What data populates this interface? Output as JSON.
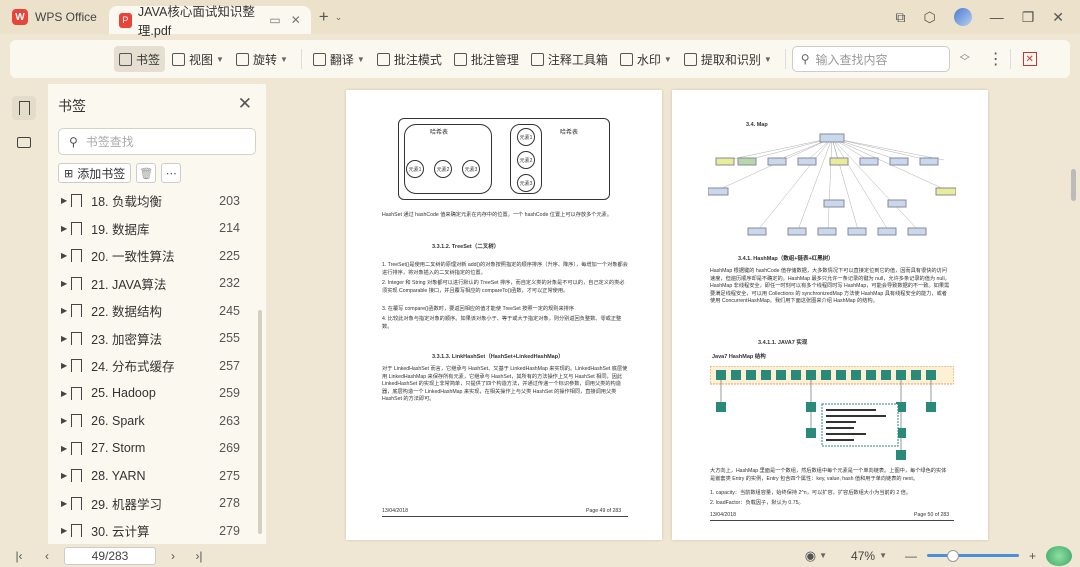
{
  "titlebar": {
    "app_name": "WPS Office",
    "doc_tab_title": "JAVA核心面试知识整理.pdf"
  },
  "toolbar": {
    "bookmark": "书签",
    "view": "视图",
    "rotate": "旋转",
    "translate": "翻译",
    "annotate_mode": "批注模式",
    "annotate_manage": "批注管理",
    "annot_tools": "注释工具箱",
    "watermark": "水印",
    "extract": "提取和识别",
    "search_placeholder": "输入查找内容"
  },
  "panel": {
    "title": "书签",
    "search_placeholder": "书签查找",
    "add_label": "添加书签",
    "items": [
      {
        "label": "18. 负载均衡",
        "page": "203"
      },
      {
        "label": "19. 数据库",
        "page": "214"
      },
      {
        "label": "20. 一致性算法",
        "page": "225"
      },
      {
        "label": "21. JAVA算法",
        "page": "232"
      },
      {
        "label": "22. 数据结构",
        "page": "245"
      },
      {
        "label": "23. 加密算法",
        "page": "255"
      },
      {
        "label": "24. 分布式缓存",
        "page": "257"
      },
      {
        "label": "25. Hadoop",
        "page": "259"
      },
      {
        "label": "26. Spark",
        "page": "263"
      },
      {
        "label": "27. Storm",
        "page": "269"
      },
      {
        "label": "28. YARN",
        "page": "275"
      },
      {
        "label": "29. 机器学习",
        "page": "278"
      },
      {
        "label": "30. 云计算",
        "page": "279"
      }
    ]
  },
  "left_page": {
    "hash_label": "哈希表",
    "hash_label2": "哈希表",
    "elements": [
      "元素1",
      "元素2",
      "元素3"
    ],
    "elements2": [
      "元素1",
      "元素2",
      "元素3"
    ],
    "para1": "HashSet 通过 hashCode 值来确定元素在内存中的位置。一个 hashCode 位置上可以存放多个元素。",
    "sec1": "3.3.1.2.    TreeSet（二叉树）",
    "list1": "1.  TreeSet()是使用二叉树的原理对新 add()的对象按照指定的顺序排序（升序、降序），每增加一个对象都会进行排序，将对象插入的二叉树指定的位置。",
    "list2": "2.  Integer 和 String 对象都可以进行默认的 TreeSet 排序，而自定义类的对象是不可以的，自己定义的类必须实现 Comparable 接口，并且覆写相应的 compareTo()函数，才可以正常使用。",
    "list3": "3.  在覆写 compare()函数时，要返回相应的值才能使 TreeSet 按照一定的规则来排序",
    "list4": "4.  比较此对象与指定对象的顺序。如果该对象小于、等于或大于指定对象，则分别返回负整数、零或正整数。",
    "sec2": "3.3.1.3.    LinkHashSet（HashSet+LinkedHashMap）",
    "para2": "对于 LinkedHashSet 而言，它继承与 HashSet、又基于 LinkedHashMap 来实现的。LinkedHashSet 底层使用 LinkedHashMap 来保存所有元素，它继承与 HashSet，其所有的方法操作上又与 HashSet 相同，因此 LinkedHashSet 的实现上非常简单，只提供了四个构造方法，并通过传递一个标识参数，调用父类的构造器，底层构造一个 LinkedHashMap 来实现，在相关操作上与父类 HashSet 的操作相同，直接调用父类 HashSet 的方法即可。",
    "footer_left": "13/04/2018",
    "footer_right": "Page 49 of 283"
  },
  "right_page": {
    "sec_top": "3.4. Map",
    "sec1": "3.4.1.  HashMap（数组+链表+红黑树）",
    "para1": "HashMap 根据键的 hashCode 值存储数据，大多数情况下可以直接定位到它的值，因而具有很快的访问速度，但遍历顺序却是不确定的。HashMap 最多只允许一条记录的键为 null，允许多条记录的值为 null。HashMap 非线程安全，即任一时刻可以有多个线程同时写 HashMap，可能会导致数据的不一致。如果需要满足线程安全，可以用 Collections 的 synchronizedMap 方法使 HashMap 具有线程安全的能力，或者使用 ConcurrentHashMap。我们用下面这张图来介绍 HashMap 的结构。",
    "sec2": "3.4.1.1.    JAVA7 实现",
    "fig_title": "Java7 HashMap 结构",
    "para2": "大方向上，HashMap 里面是一个数组，然后数组中每个元素是一个单向链表。上图中，每个绿色的实体是嵌套类 Entry 的实例，Entry 包含四个属性：key, value, hash 值和用于单向链表的 next。",
    "list1": "1.  capacity：当前数组容量，始终保持 2^n，可以扩容，扩容后数组大小为当前的 2 倍。",
    "list2": "2.  loadFactor：负载因子，默认为 0.75。",
    "footer_left": "13/04/2018",
    "footer_right": "Page 50 of 283"
  },
  "status": {
    "page_indicator": "49/283",
    "zoom": "47%"
  }
}
